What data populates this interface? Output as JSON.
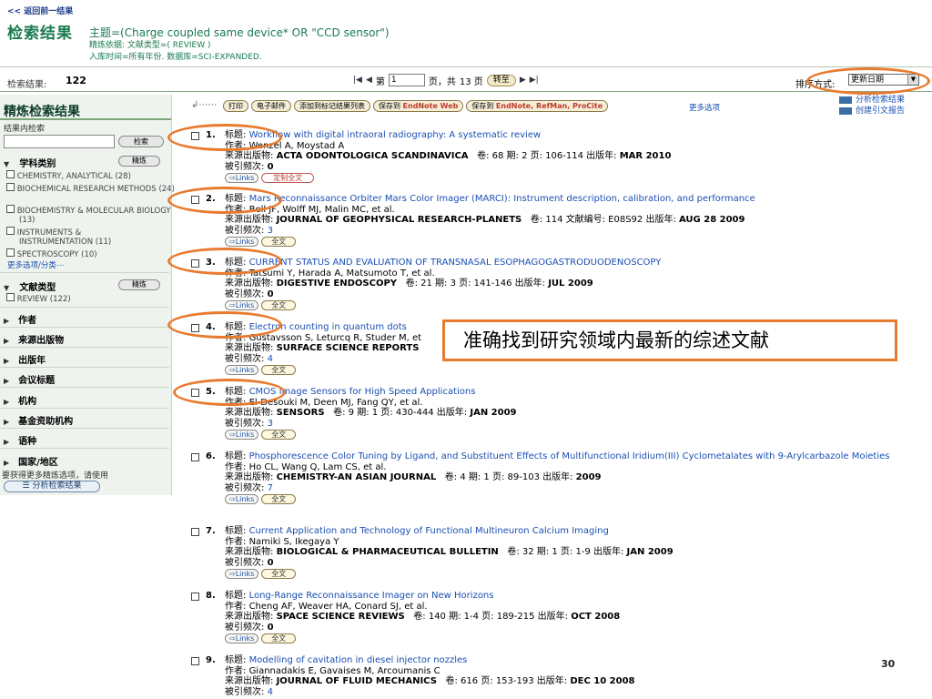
{
  "header": {
    "back_link": "<< 返回前一结果",
    "title": "检索结果",
    "topic": "主题=(Charge coupled same device* OR \"CCD sensor\")",
    "refine_basis": "精炼依据: 文献类型=( REVIEW )",
    "refine_range": "入库时间=所有年份. 数据库=SCI-EXPANDED."
  },
  "results_bar": {
    "count_label": "检索结果:",
    "count": "122",
    "page_prefix": "第",
    "page_value": "1",
    "page_suffix": "页，共",
    "total_pages": "13 页",
    "goto_label": "转至",
    "sort_label": "排序方式:",
    "sort_value": "更新日期"
  },
  "sidebar": {
    "title": "精炼检索结果",
    "inner_search_label": "结果内检索",
    "search_button": "检索",
    "refine_button": "精炼",
    "subject": {
      "label": "学科类别",
      "options": [
        "CHEMISTRY, ANALYTICAL (28)",
        "BIOCHEMICAL RESEARCH METHODS (24)",
        "BIOCHEMISTRY & MOLECULAR BIOLOGY (13)",
        "INSTRUMENTS & INSTRUMENTATION (11)",
        "SPECTROSCOPY (10)"
      ],
      "more": "更多选项/分类⋯"
    },
    "doctype": {
      "label": "文献类型",
      "options": [
        "REVIEW (122)"
      ]
    },
    "categories": [
      "作者",
      "来源出版物",
      "出版年",
      "会议标题",
      "机构",
      "基金资助机构",
      "语种",
      "国家/地区"
    ],
    "bottom_note": "要获得更多精炼选项，请使用",
    "analyze_button": "分析检索结果"
  },
  "toolbar": {
    "print": "打印",
    "email": "电子邮件",
    "add_marked": "添加到标记结果列表",
    "save_endnote_web_prefix": "保存到",
    "save_endnote_web_brand": "EndNote Web",
    "save_endnote_prefix": "保存到",
    "save_endnote_brand": "EndNote, RefMan, ProCite",
    "more_options": "更多选项",
    "analyze_results": "分析检索结果",
    "citation_report": "创建引文报告"
  },
  "labels": {
    "title": "标题:",
    "authors": "作者:",
    "source": "来源出版物:",
    "cited": "被引频次:",
    "links": "Links",
    "custom_fulltext": "定制全文",
    "fulltext": "全文"
  },
  "records": [
    {
      "num": "1.",
      "title": "Workflow with digital intraoral radiography: A systematic review",
      "authors": "Wenzel A, Moystad A",
      "source": "ACTA ODONTOLOGICA SCANDINAVICA",
      "details": "卷: 68  期: 2  页: 106-114  出版年: ",
      "year": "MAR 2010",
      "cited": "0",
      "fulltext": "定制全文"
    },
    {
      "num": "2.",
      "title": "Mars Reconnaissance Orbiter Mars Color Imager (MARCI): Instrument description, calibration, and performance",
      "authors": "Bell JF, Wolff MJ, Malin MC, et al.",
      "source": "JOURNAL OF GEOPHYSICAL RESEARCH-PLANETS",
      "details": "卷: 114 文献编号: E08S92  出版年: ",
      "year": "AUG 28 2009",
      "cited": "3",
      "fulltext": "全文"
    },
    {
      "num": "3.",
      "title": "CURRENT STATUS AND EVALUATION OF TRANSNASAL ESOPHAGOGASTRODUODENOSCOPY",
      "authors": "Tatsumi Y, Harada A, Matsumoto T, et al.",
      "source": "DIGESTIVE ENDOSCOPY",
      "details": "卷: 21  期: 3  页: 141-146  出版年: ",
      "year": "JUL 2009",
      "cited": "0",
      "fulltext": "全文"
    },
    {
      "num": "4.",
      "title": "Electron counting in quantum dots",
      "authors": "Gustavsson S, Leturcq R, Studer M, et",
      "source": "SURFACE SCIENCE REPORTS",
      "details": "",
      "year": "",
      "cited": "4",
      "fulltext": "全文"
    },
    {
      "num": "5.",
      "title": "CMOS Image Sensors for High Speed Applications",
      "authors": "El-Desouki M, Deen MJ, Fang QY, et al.",
      "source": "SENSORS",
      "details": "卷: 9  期: 1  页: 430-444  出版年: ",
      "year": "JAN 2009",
      "cited": "3",
      "fulltext": "全文"
    },
    {
      "num": "6.",
      "title": "Phosphorescence Color Tuning by Ligand, and Substituent Effects of Multifunctional Iridium(III) Cyclometalates with 9-Arylcarbazole Moieties",
      "authors": "Ho CL, Wang Q, Lam CS, et al.",
      "source": "CHEMISTRY-AN ASIAN JOURNAL",
      "details": "卷: 4  期: 1  页: 89-103  出版年: ",
      "year": "2009",
      "cited": "7",
      "fulltext": "全文"
    },
    {
      "num": "7.",
      "title": "Current Application and Technology of Functional Multineuron Calcium Imaging",
      "authors": "Namiki S, Ikegaya Y",
      "source": "BIOLOGICAL & PHARMACEUTICAL BULLETIN",
      "details": "卷: 32  期: 1  页: 1-9  出版年: ",
      "year": "JAN 2009",
      "cited": "0",
      "fulltext": "全文"
    },
    {
      "num": "8.",
      "title": "Long-Range Reconnaissance Imager on New Horizons",
      "authors": "Cheng AF, Weaver HA, Conard SJ, et al.",
      "source": "SPACE SCIENCE REVIEWS",
      "details": "卷: 140  期: 1-4  页: 189-215  出版年: ",
      "year": "OCT 2008",
      "cited": "0",
      "fulltext": "全文"
    },
    {
      "num": "9.",
      "title": "Modelling of cavitation in diesel injector nozzles",
      "authors": "Giannadakis E, Gavaises M, Arcoumanis C",
      "source": "JOURNAL OF FLUID MECHANICS",
      "details": "卷: 616  页: 153-193  出版年: ",
      "year": "DEC 10 2008",
      "cited": "4",
      "fulltext": ""
    }
  ],
  "annotation": {
    "callout": "准确找到研究领域内最新的综述文献",
    "slide_number": "30",
    "color": "#e87b2f"
  }
}
